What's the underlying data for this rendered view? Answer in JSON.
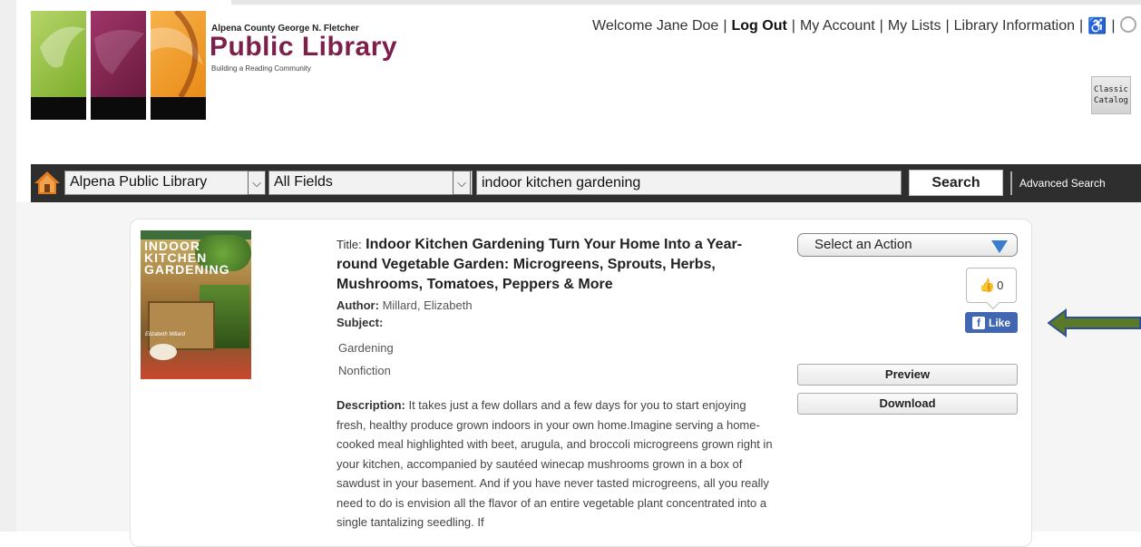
{
  "library": {
    "name_small": "Alpena County George N. Fletcher",
    "name_big": "Public Library",
    "tagline": "Building a Reading Community"
  },
  "topnav": {
    "welcome": "Welcome Jane Doe",
    "logout": "Log Out",
    "my_account": "My Account",
    "my_lists": "My Lists",
    "library_info": "Library Information",
    "separator": "|"
  },
  "classic_catalog": {
    "line1": "Classic",
    "line2": "Catalog"
  },
  "search": {
    "library_select": "Alpena Public Library",
    "field_select": "All Fields",
    "query": "indoor kitchen gardening",
    "button": "Search",
    "advanced": "Advanced Search"
  },
  "result": {
    "title_label": "Title:",
    "title": "Indoor Kitchen Gardening Turn Your Home Into a Year-round Vegetable Garden: Microgreens, Sprouts, Herbs, Mushrooms, Tomatoes, Peppers & More",
    "author_label": "Author:",
    "author": "Millard, Elizabeth",
    "subject_label": "Subject:",
    "subjects": [
      "Gardening",
      "Nonfiction"
    ],
    "description_label": "Description:",
    "description": "It takes just a few dollars and a few days for you to start enjoying fresh, healthy produce grown indoors in your own home.Imagine serving a home-cooked meal highlighted with beet, arugula, and broccoli microgreens grown right in your kitchen, accompanied by sautéed winecap mushrooms grown in a box of sawdust in your basement. And if you have never tasted microgreens, all you really need to do is envision all the flavor of an entire vegetable plant concentrated into a single tantalizing seedling. If",
    "cover_text": "INDOOR KITCHEN GARDENING",
    "cover_author": "Elizabeth Millard"
  },
  "actions": {
    "select_action": "Select an Action",
    "like_count": "0",
    "fb_like": "Like",
    "preview": "Preview",
    "download": "Download"
  },
  "colors": {
    "brand_maroon": "#7d1f4b",
    "bar_dark": "#2e2e2e",
    "facebook_blue": "#4267b2",
    "arrow_green": "#5a7a2a",
    "arrow_outline": "#2f4f8f"
  }
}
